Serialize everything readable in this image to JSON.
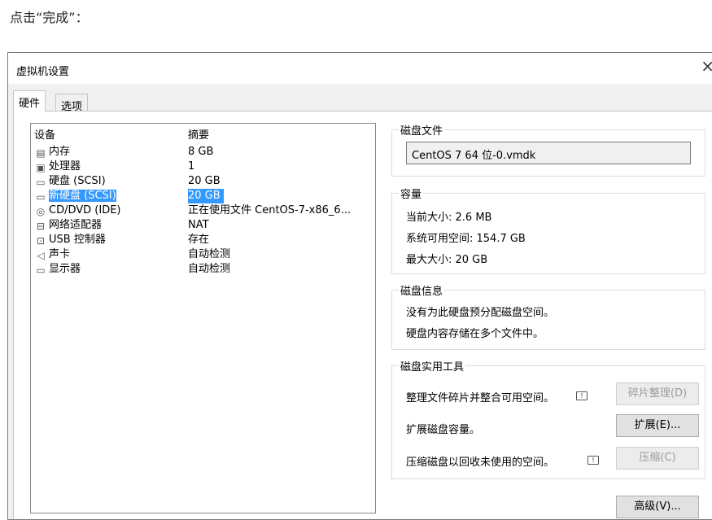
{
  "caption": "点击“完成”：",
  "dialog": {
    "title": "虚拟机设置",
    "close_glyph": "×",
    "tabs": [
      {
        "label": "硬件",
        "active": true
      },
      {
        "label": "选项",
        "active": false
      }
    ],
    "device_list": {
      "header_device": "设备",
      "header_summary": "摘要",
      "items": [
        {
          "name": "内存",
          "summary": "8 GB",
          "icon": "memory-icon"
        },
        {
          "name": "处理器",
          "summary": "1",
          "icon": "processor-icon"
        },
        {
          "name": "硬盘 (SCSI)",
          "summary": "20 GB",
          "icon": "hard-disk-icon"
        },
        {
          "name": "新硬盘 (SCSI)",
          "summary": "20 GB",
          "icon": "hard-disk-icon",
          "selected": true
        },
        {
          "name": "CD/DVD (IDE)",
          "summary": "正在使用文件 CentOS-7-x86_6...",
          "icon": "cd-dvd-icon"
        },
        {
          "name": "网络适配器",
          "summary": "NAT",
          "icon": "network-adapter-icon"
        },
        {
          "name": "USB 控制器",
          "summary": "存在",
          "icon": "usb-icon"
        },
        {
          "name": "声卡",
          "summary": "自动检测",
          "icon": "speaker-icon"
        },
        {
          "name": "显示器",
          "summary": "自动检测",
          "icon": "monitor-icon"
        }
      ]
    },
    "disk_file": {
      "title": "磁盘文件",
      "value": "CentOS 7 64 位-0.vmdk"
    },
    "capacity": {
      "title": "容量",
      "current": "当前大小: 2.6 MB",
      "available": "系统可用空间: 154.7 GB",
      "max": "最大大小: 20 GB"
    },
    "disk_info": {
      "title": "磁盘信息",
      "line1": "没有为此硬盘预分配磁盘空间。",
      "line2": "硬盘内容存储在多个文件中。"
    },
    "disk_utilities": {
      "title": "磁盘实用工具",
      "defrag_text": "整理文件碎片并整合可用空间。",
      "defrag_button": "碎片整理(D)",
      "expand_text": "扩展磁盘容量。",
      "expand_button": "扩展(E)...",
      "compact_text": "压缩磁盘以回收未使用的空间。",
      "compact_button": "压缩(C)"
    },
    "advanced_button": "高级(V)..."
  }
}
